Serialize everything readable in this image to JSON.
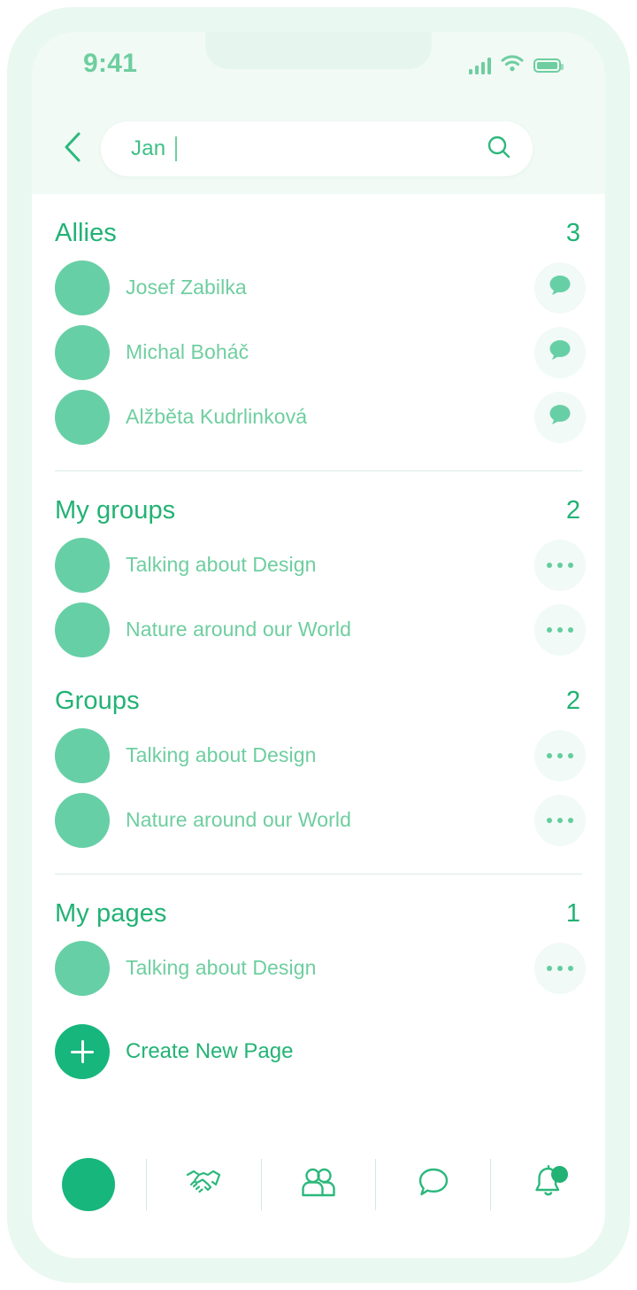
{
  "status_bar": {
    "time": "9:41",
    "signal_icon": "signal-bars-icon",
    "wifi_icon": "wifi-icon",
    "battery_icon": "battery-full-icon"
  },
  "search": {
    "back_icon": "chevron-left-icon",
    "value": "Jan",
    "placeholder": "Search",
    "search_icon": "search-icon"
  },
  "sections": [
    {
      "title": "Allies",
      "count": "3",
      "items": [
        {
          "label": "Josef Zabilka",
          "action_icon": "chat-bubble-icon"
        },
        {
          "label": "Michal Boháč",
          "action_icon": "chat-bubble-icon"
        },
        {
          "label": "Alžběta Kudrlinková",
          "action_icon": "chat-bubble-icon"
        }
      ]
    },
    {
      "title": "My groups",
      "count": "2",
      "items": [
        {
          "label": "Talking about Design",
          "action_icon": "more-options-icon"
        },
        {
          "label": "Nature around our World",
          "action_icon": "more-options-icon"
        }
      ]
    },
    {
      "title": "Groups",
      "count": "2",
      "items": [
        {
          "label": "Talking about Design",
          "action_icon": "more-options-icon"
        },
        {
          "label": "Nature around our World",
          "action_icon": "more-options-icon"
        }
      ]
    },
    {
      "title": "My pages",
      "count": "1",
      "items": [
        {
          "label": "Talking about Design",
          "action_icon": "more-options-icon"
        }
      ]
    }
  ],
  "create_page": {
    "label": "Create New Page",
    "icon": "plus-icon"
  },
  "bottom_nav": [
    {
      "name": "profile-avatar",
      "icon": "avatar-icon"
    },
    {
      "name": "allies",
      "icon": "handshake-icon"
    },
    {
      "name": "groups",
      "icon": "people-icon"
    },
    {
      "name": "messages",
      "icon": "chat-bubble-outline-icon"
    },
    {
      "name": "notifications",
      "icon": "bell-icon",
      "badge": true
    }
  ],
  "colors": {
    "accent": "#22b274",
    "accent_light": "#6ece9f",
    "avatar": "#67cfa6",
    "frame": "#e9f8f0",
    "top_bg": "#f1faf5",
    "action_bg": "#f1faf6",
    "divider": "#d9ebe3"
  }
}
